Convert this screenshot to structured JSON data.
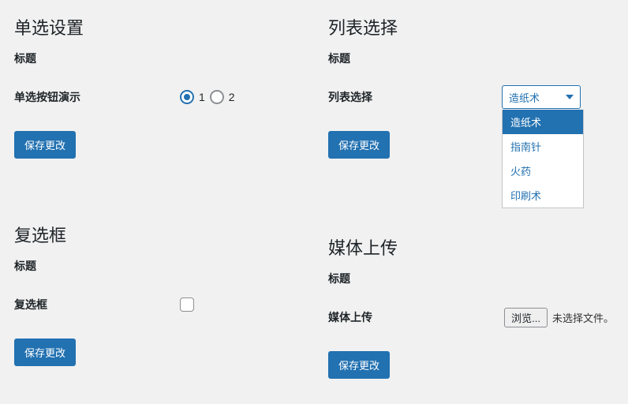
{
  "radio_section": {
    "heading": "单选设置",
    "subhead": "标题",
    "field_label": "单选按钮演示",
    "options": {
      "opt1": "1",
      "opt2": "2"
    },
    "save_label": "保存更改"
  },
  "select_section": {
    "heading": "列表选择",
    "subhead": "标题",
    "field_label": "列表选择",
    "selected": "造纸术",
    "options": {
      "o1": "造纸术",
      "o2": "指南针",
      "o3": "火药",
      "o4": "印刷术"
    },
    "save_label": "保存更改"
  },
  "checkbox_section": {
    "heading": "复选框",
    "subhead": "标题",
    "field_label": "复选框",
    "save_label": "保存更改"
  },
  "upload_section": {
    "heading": "媒体上传",
    "subhead": "标题",
    "field_label": "媒体上传",
    "browse_label": "浏览...",
    "file_status": "未选择文件。",
    "save_label": "保存更改"
  }
}
